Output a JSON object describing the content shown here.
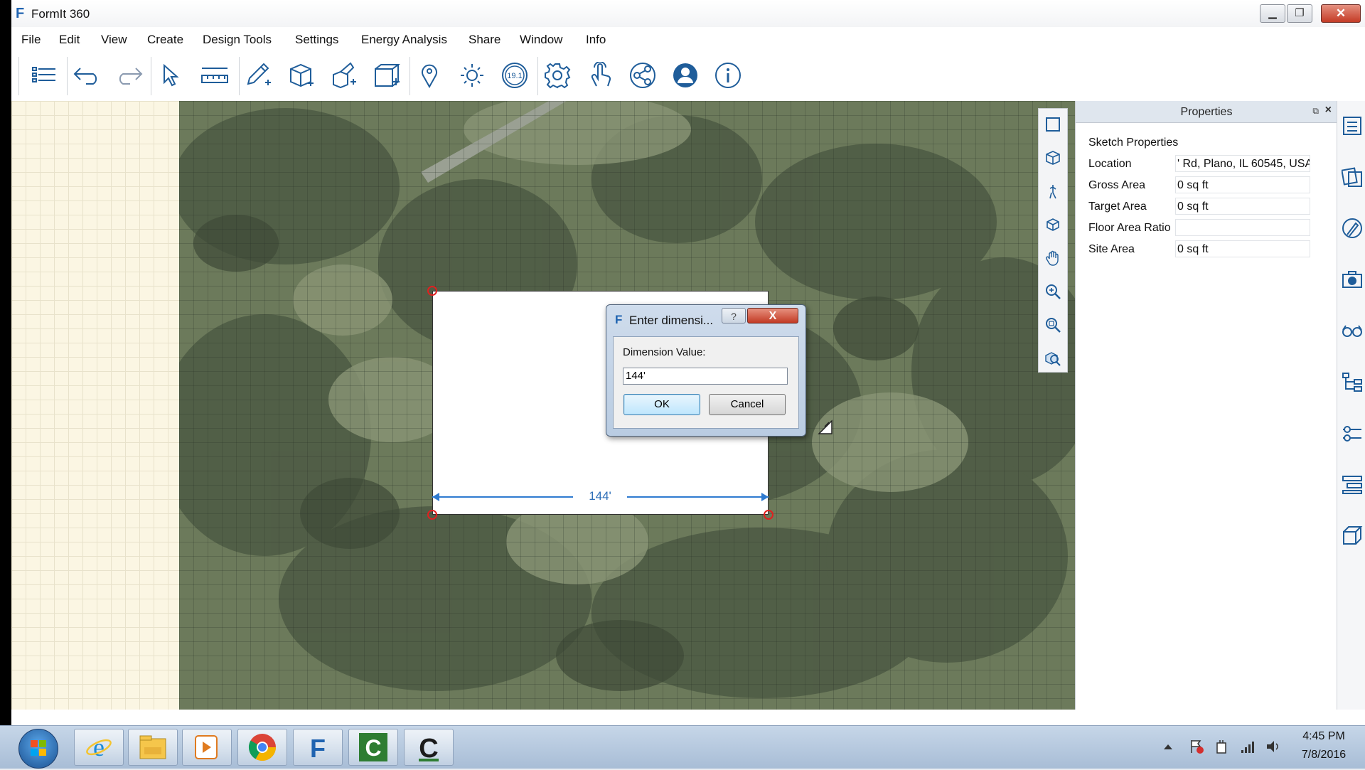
{
  "window": {
    "title": "FormIt 360",
    "logo_letter": "F"
  },
  "menu": [
    "File",
    "Edit",
    "View",
    "Create",
    "Design Tools",
    "Settings",
    "Energy Analysis",
    "Share",
    "Window",
    "Info"
  ],
  "toolbar": {
    "icons": [
      "layers-icon",
      "undo-icon",
      "redo-icon",
      "select-icon",
      "dimension-icon",
      "sketch-icon",
      "cube-icon",
      "add-cube-icon",
      "box-icon",
      "location-pin-icon",
      "sun-icon",
      "version-badge-icon",
      "settings-gear-icon",
      "touch-icon",
      "share-icon",
      "user-icon",
      "info-icon"
    ],
    "version_badge": "19.1"
  },
  "canvas": {
    "dimension_label": "144'"
  },
  "dialog": {
    "logo": "F",
    "title": "Enter dimensi...",
    "help": "?",
    "close": "X",
    "label": "Dimension Value:",
    "value": "144'",
    "ok": "OK",
    "cancel": "Cancel"
  },
  "properties": {
    "header": "Properties",
    "section": "Sketch Properties",
    "rows": [
      {
        "label": "Location",
        "value": "' Rd, Plano, IL 60545, USA"
      },
      {
        "label": "Gross Area",
        "value": "0 sq ft"
      },
      {
        "label": "Target Area",
        "value": "0 sq ft"
      },
      {
        "label": "Floor Area Ratio",
        "value": ""
      },
      {
        "label": "Site Area",
        "value": "0 sq ft"
      }
    ]
  },
  "taskbar": {
    "apps": [
      "internet-explorer-icon",
      "file-explorer-icon",
      "media-player-icon",
      "chrome-icon",
      "formit-icon",
      "camtasia-icon",
      "camtasia-recorder-icon"
    ],
    "time": "4:45 PM",
    "date": "7/8/2016"
  },
  "colors": {
    "accent_blue": "#2f7bd0",
    "point_red": "#e02020",
    "formit_blue": "#1f63b0"
  }
}
